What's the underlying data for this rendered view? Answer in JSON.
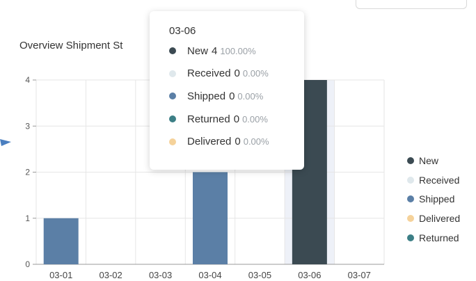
{
  "chart_data": {
    "type": "bar",
    "title": "Overview Shipment St",
    "categories": [
      "03-01",
      "03-02",
      "03-03",
      "03-04",
      "03-05",
      "03-06",
      "03-07"
    ],
    "series": [
      {
        "name": "New",
        "color": "#3b4a52",
        "values": [
          0,
          0,
          0,
          0,
          0,
          4,
          0
        ]
      },
      {
        "name": "Received",
        "color": "#dfe8ec",
        "values": [
          0,
          0,
          0,
          0,
          0,
          0,
          0
        ]
      },
      {
        "name": "Shipped",
        "color": "#5b7fa6",
        "values": [
          1,
          0,
          0,
          2,
          0,
          0,
          0
        ]
      },
      {
        "name": "Delivered",
        "color": "#f5d29a",
        "values": [
          0,
          0,
          0,
          0,
          0,
          0,
          0
        ]
      },
      {
        "name": "Returned",
        "color": "#3c7f86",
        "values": [
          0,
          0,
          0,
          0,
          0,
          0,
          0
        ]
      }
    ],
    "ylim": [
      0,
      4
    ],
    "yticks": [
      "0",
      "1",
      "2",
      "3",
      "4"
    ],
    "grid": true,
    "legend_position": "right",
    "highlighted_category": "03-06"
  },
  "tooltip": {
    "title": "03-06",
    "rows": [
      {
        "name": "New",
        "value": "4",
        "percent": "100.00%",
        "color": "#3b4a52"
      },
      {
        "name": "Received",
        "value": "0",
        "percent": "0.00%",
        "color": "#dfe8ec"
      },
      {
        "name": "Shipped",
        "value": "0",
        "percent": "0.00%",
        "color": "#5b7fa6"
      },
      {
        "name": "Returned",
        "value": "0",
        "percent": "0.00%",
        "color": "#3c7f86"
      },
      {
        "name": "Delivered",
        "value": "0",
        "percent": "0.00%",
        "color": "#f5d29a"
      }
    ]
  },
  "colors": {
    "grid": "#e6e6e6",
    "axis": "#999999",
    "highlight_band": "#eef1f8",
    "arrow": "#4a7fc0"
  }
}
